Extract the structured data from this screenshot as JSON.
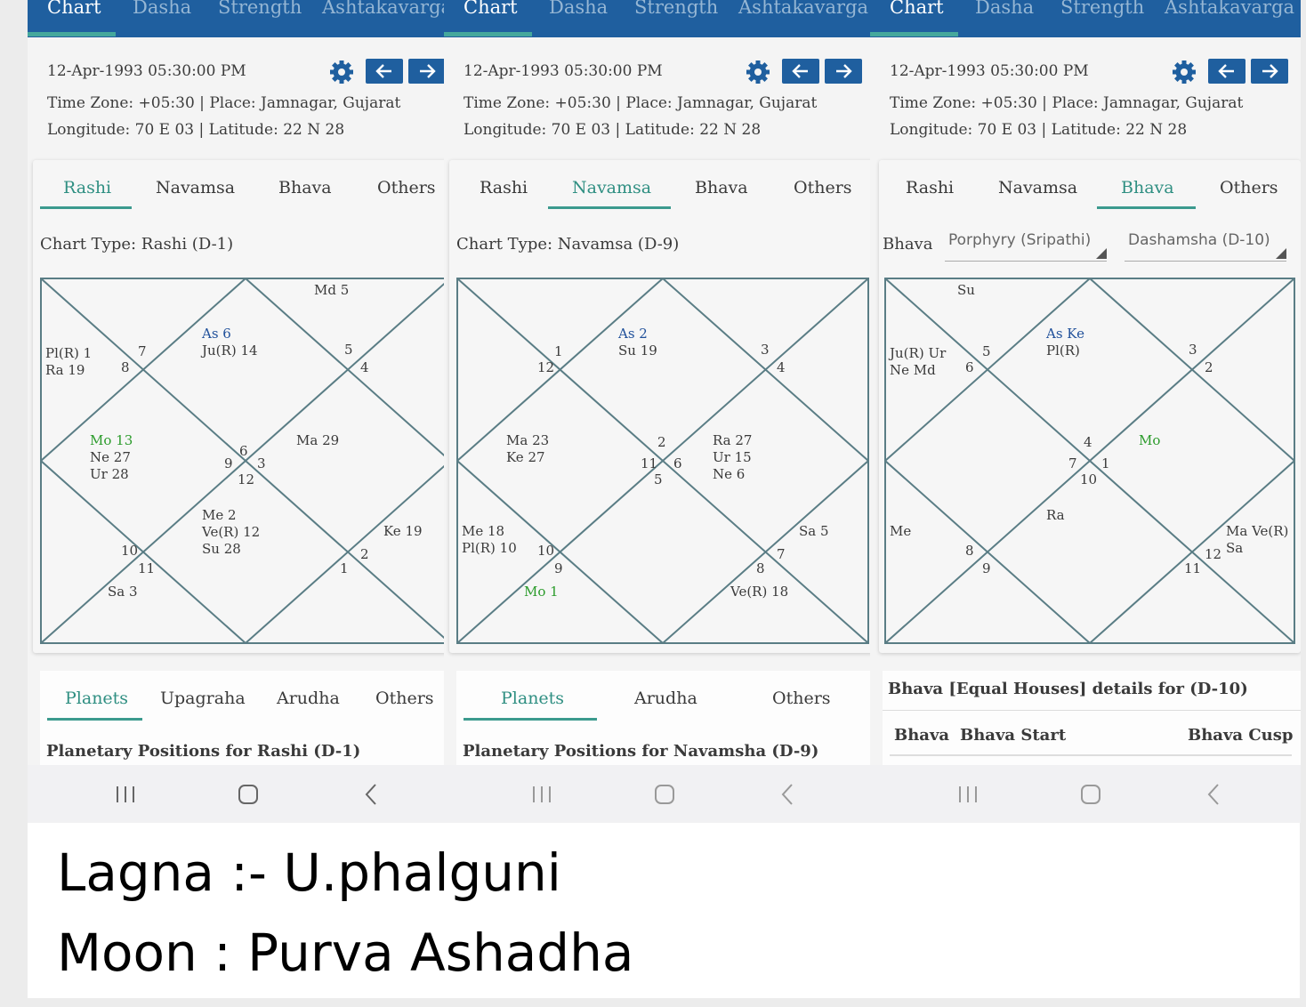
{
  "top_tabs": [
    "Chart",
    "Dasha",
    "Strength",
    "Ashtakavarga"
  ],
  "info": {
    "datetime": "12-Apr-1993 05:30:00 PM",
    "timezone_line": "Time Zone: +05:30 | Place: Jamnagar, Gujarat",
    "longlat_line": "Longitude: 70 E 03 | Latitude: 22 N 28"
  },
  "chart_tabs": [
    "Rashi",
    "Navamsa",
    "Bhava",
    "Others"
  ],
  "panels": [
    {
      "chart_type": "Chart Type: Rashi (D-1)",
      "houses": [
        {
          "label": "As 6",
          "label_color": "blue",
          "lines": [
            "Ju(R) 14"
          ],
          "sign": "6"
        },
        {
          "label": "",
          "lines": [
            "Md 5"
          ],
          "sign": "5"
        },
        {
          "label": "",
          "lines": [
            "Ma 29"
          ],
          "sign": "4"
        },
        {
          "label": "",
          "lines": [],
          "sign": "3"
        },
        {
          "label": "",
          "lines": [
            "Ke 19"
          ],
          "sign": "2"
        },
        {
          "label": "",
          "lines": [],
          "sign": "1"
        },
        {
          "label": "",
          "lines": [
            "Me 2",
            "Ve(R) 12",
            "Su 28"
          ],
          "sign": "12"
        },
        {
          "label": "",
          "lines": [
            "Sa 3"
          ],
          "sign": "11"
        },
        {
          "label": "",
          "lines": [],
          "sign": "10"
        },
        {
          "label": "Mo 13",
          "label_color": "green",
          "lines": [
            "Ne 27",
            "Ur 28"
          ],
          "sign": "9"
        },
        {
          "label": "",
          "lines": [
            "Pl(R) 1",
            "Ra 19"
          ],
          "sign": "8"
        },
        {
          "label": "",
          "lines": [],
          "sign": "7"
        }
      ],
      "bottom_tabs": [
        "Planets",
        "Upagraha",
        "Arudha",
        "Others"
      ],
      "bottom_title": "Planetary Positions for Rashi (D-1)"
    },
    {
      "chart_type": "Chart Type: Navamsa (D-9)",
      "houses": [
        {
          "label": "As 2",
          "label_color": "blue",
          "lines": [
            "Su 19"
          ],
          "sign": "2"
        },
        {
          "label": "",
          "lines": [],
          "sign": "1"
        },
        {
          "label": "",
          "lines": [
            "Ma 23",
            "Ke 27"
          ],
          "sign": "12"
        },
        {
          "label": "",
          "lines": [],
          "sign": "11"
        },
        {
          "label": "",
          "lines": [
            "Me 18",
            "Pl(R) 10"
          ],
          "sign": "10"
        },
        {
          "label": "",
          "lines": [],
          "sign": "9"
        },
        {
          "label": "",
          "lines": [
            "Ve(R) 18"
          ],
          "sign": "8"
        },
        {
          "label": "",
          "lines": [
            "Sa 5"
          ],
          "sign": "7"
        },
        {
          "label": "",
          "lines": [],
          "sign": "6"
        },
        {
          "label": "",
          "lines": [
            "Ra 27",
            "Ur 15",
            "Ne 6"
          ],
          "sign": "5"
        },
        {
          "label": "",
          "lines": [],
          "sign": "4"
        },
        {
          "label": "",
          "lines": [],
          "sign": "3"
        }
      ],
      "extra_green": "Mo 1",
      "bottom_tabs": [
        "Planets",
        "Arudha",
        "Others"
      ],
      "bottom_title": "Planetary Positions for Navamsha (D-9)"
    },
    {
      "bhava_label": "Bhava",
      "select_1": "Porphyry (Sripathi)",
      "select_2": "Dashamsha (D-10)",
      "houses": [
        {
          "label": "As Ke",
          "label_color": "blue",
          "lines": [
            "Pl(R)"
          ],
          "sign": "4"
        },
        {
          "label": "",
          "lines": [
            "Su"
          ],
          "sign": "3"
        },
        {
          "label": "",
          "lines": [
            "Ju(R) Ur",
            "Ne Md"
          ],
          "sign": "2"
        },
        {
          "label": "",
          "lines": [],
          "sign": "1"
        },
        {
          "label": "",
          "lines": [
            "Me"
          ],
          "sign": "12"
        },
        {
          "label": "",
          "lines": [],
          "sign": "11"
        },
        {
          "label": "",
          "lines": [
            "Ra"
          ],
          "sign": "10"
        },
        {
          "label": "",
          "lines": [],
          "sign": "9"
        },
        {
          "label": "",
          "lines": [
            "Ma Ve(R)",
            "Sa"
          ],
          "sign": "8"
        },
        {
          "label": "Mo",
          "label_color": "green",
          "lines": [],
          "sign": "7"
        },
        {
          "label": "",
          "lines": [],
          "sign": "6"
        },
        {
          "label": "",
          "lines": [],
          "sign": "5"
        }
      ],
      "bottom_title": "Bhava [Equal Houses] details for (D-10)",
      "table_headers": [
        "Bhava",
        "Bhava Start",
        "Bhava Cusp"
      ]
    }
  ],
  "caption": {
    "line1": "Lagna :- U.phalguni",
    "line2": "Moon : Purva Ashadha"
  },
  "colors": {
    "nav_blue": "#1f5f9f",
    "teal_accent": "#3c9a8e",
    "chart_line": "#5a7d85",
    "lagna_blue": "#20509a",
    "moon_green": "#2b9b2b"
  },
  "icons": [
    "gear-icon",
    "arrow-left-icon",
    "arrow-right-icon",
    "recent-apps-icon",
    "home-icon",
    "back-icon"
  ]
}
